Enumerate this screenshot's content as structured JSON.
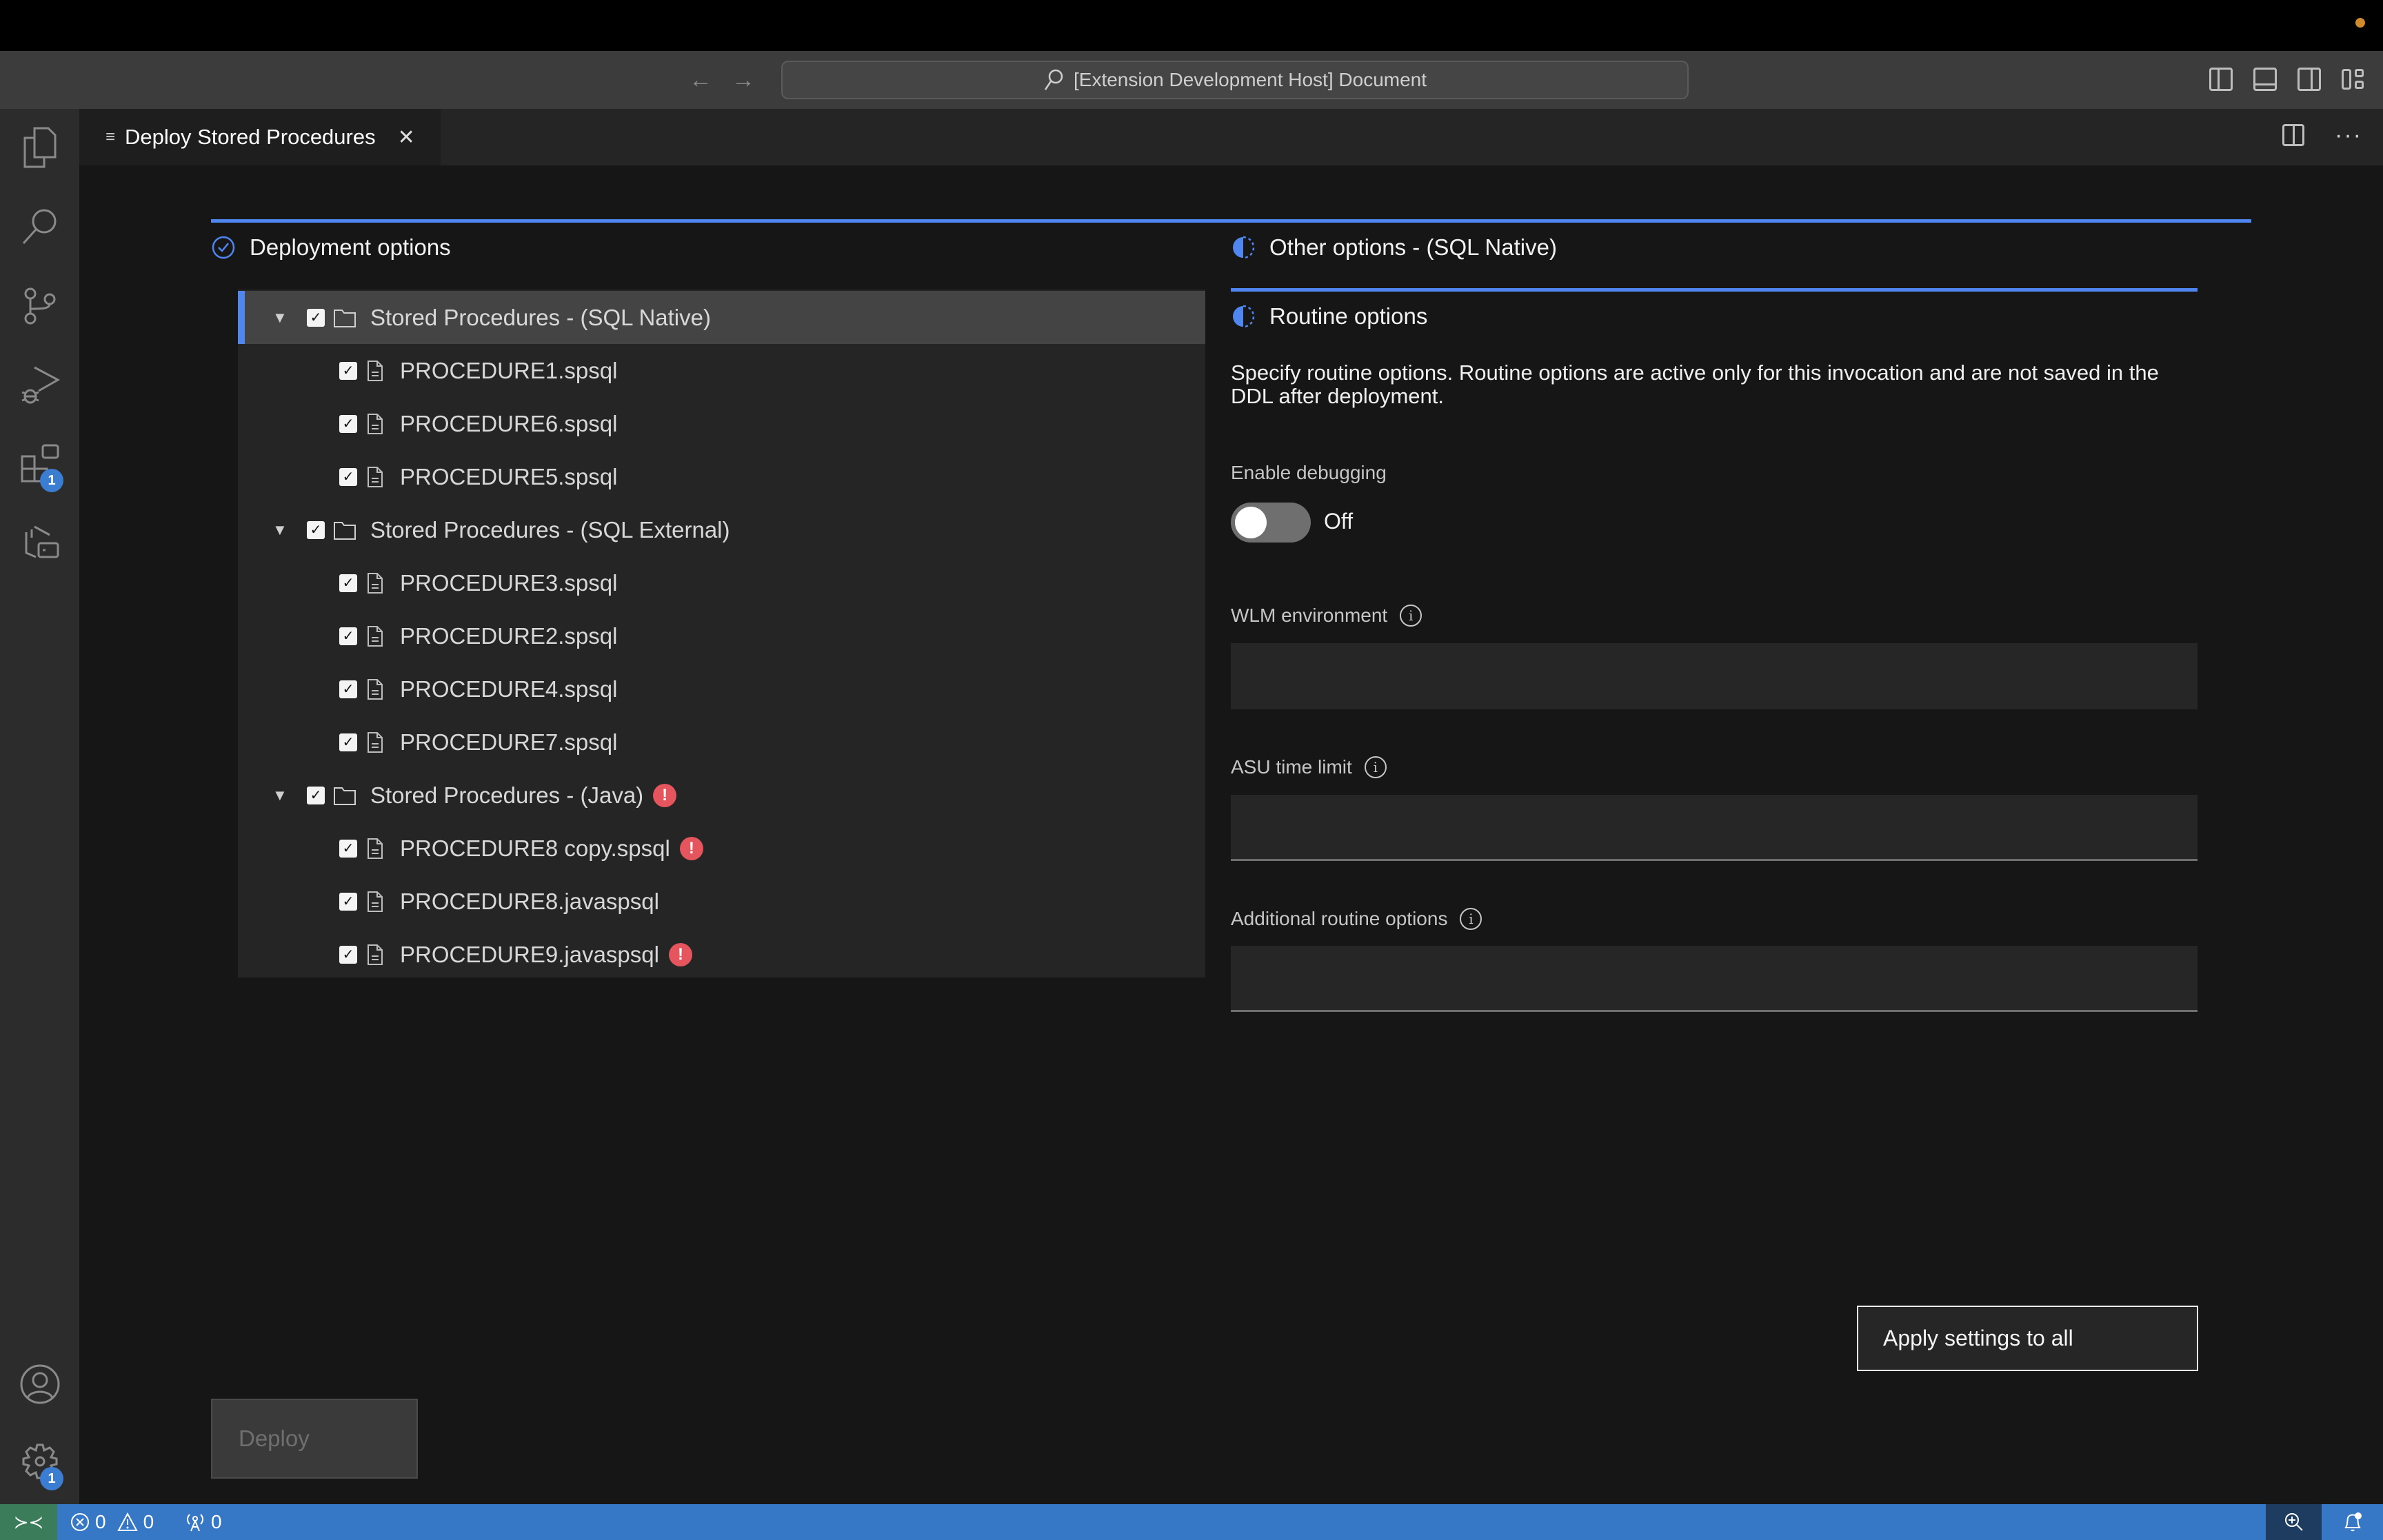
{
  "window": {
    "command_center_text": "[Extension Development Host] Document"
  },
  "activity_bar": {
    "items": [
      {
        "icon": "explorer-icon"
      },
      {
        "icon": "search-icon"
      },
      {
        "icon": "source-control-icon"
      },
      {
        "icon": "run-debug-icon"
      },
      {
        "icon": "extensions-icon",
        "badge": "1"
      },
      {
        "icon": "remote-explorer-icon"
      }
    ],
    "bottom": [
      {
        "icon": "account-icon"
      },
      {
        "icon": "manage-gear-icon",
        "badge": "1"
      }
    ]
  },
  "tab": {
    "label": "Deploy Stored Procedures",
    "close_glyph": "✕"
  },
  "left": {
    "section_title": "Deployment options",
    "tree": [
      {
        "label": "Stored Procedures - (SQL Native)",
        "type": "folder",
        "checked": true,
        "expanded": true,
        "selected": true,
        "error": false,
        "children": [
          {
            "label": "PROCEDURE1.spsql",
            "checked": true,
            "error": false
          },
          {
            "label": "PROCEDURE6.spsql",
            "checked": true,
            "error": false
          },
          {
            "label": "PROCEDURE5.spsql",
            "checked": true,
            "error": false
          }
        ]
      },
      {
        "label": "Stored Procedures - (SQL External)",
        "type": "folder",
        "checked": true,
        "expanded": true,
        "selected": false,
        "error": false,
        "children": [
          {
            "label": "PROCEDURE3.spsql",
            "checked": true,
            "error": false
          },
          {
            "label": "PROCEDURE2.spsql",
            "checked": true,
            "error": false
          },
          {
            "label": "PROCEDURE4.spsql",
            "checked": true,
            "error": false
          },
          {
            "label": "PROCEDURE7.spsql",
            "checked": true,
            "error": false
          }
        ]
      },
      {
        "label": "Stored Procedures - (Java)",
        "type": "folder",
        "checked": true,
        "expanded": true,
        "selected": false,
        "error": true,
        "children": [
          {
            "label": "PROCEDURE8 copy.spsql",
            "checked": true,
            "error": true
          },
          {
            "label": "PROCEDURE8.javaspsql",
            "checked": true,
            "error": false
          },
          {
            "label": "PROCEDURE9.javaspsql",
            "checked": true,
            "error": true
          }
        ]
      }
    ],
    "deploy_label": "Deploy"
  },
  "right": {
    "other_options_title": "Other options - (SQL Native)",
    "routine_options_title": "Routine options",
    "description": "Specify routine options. Routine options are active only for this invocation and are not saved in the DDL after deployment.",
    "enable_debugging_label": "Enable debugging",
    "enable_debugging_state": "Off",
    "wlm_label": "WLM environment",
    "wlm_value": "",
    "asu_label": "ASU time limit",
    "asu_value": "",
    "additional_label": "Additional routine options",
    "additional_value": "",
    "apply_label": "Apply settings to all"
  },
  "status_bar": {
    "errors": "0",
    "warnings": "0",
    "ports": "0"
  },
  "colors": {
    "accent": "#4f86f0",
    "status_bar": "#3677c6",
    "remote": "#3b7d5b",
    "error": "#e5555e"
  }
}
